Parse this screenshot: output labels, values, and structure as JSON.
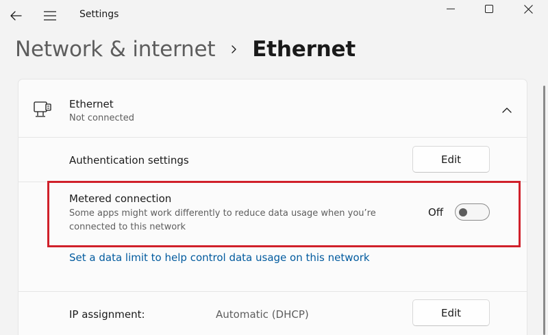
{
  "window": {
    "title": "Settings"
  },
  "breadcrumb": {
    "parent": "Network & internet",
    "current": "Ethernet"
  },
  "ethernet": {
    "title": "Ethernet",
    "status": "Not connected"
  },
  "authentication": {
    "label": "Authentication settings",
    "button_label": "Edit"
  },
  "metered": {
    "title": "Metered connection",
    "description": "Some apps might work differently to reduce data usage when you’re connected to this network",
    "toggle_state": "Off",
    "toggle_on": false
  },
  "data_limit_link": "Set a data limit to help control data usage on this network",
  "ip_assignment": {
    "label": "IP assignment:",
    "value": "Automatic (DHCP)",
    "button_label": "Edit"
  },
  "colors": {
    "link": "#005a9e",
    "highlight": "#d0202a",
    "background": "#f3f3f3",
    "card": "#fbfbfb"
  },
  "icons": {
    "back": "back-arrow-icon",
    "menu": "hamburger-menu-icon",
    "ethernet": "ethernet-icon",
    "collapse": "chevron-up-icon",
    "separator": "chevron-right-icon"
  }
}
